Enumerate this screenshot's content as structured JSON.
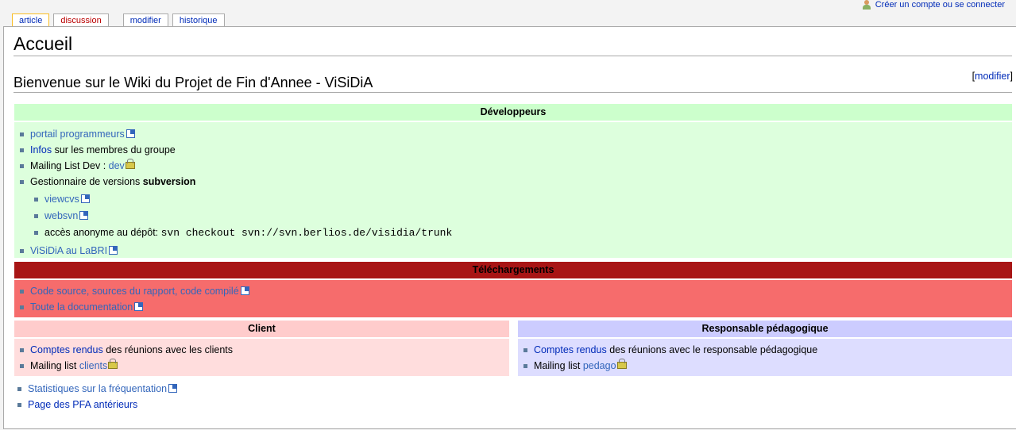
{
  "tabs": [
    "article",
    "discussion",
    "modifier",
    "historique"
  ],
  "personal": "Créer un compte ou se connecter",
  "title": "Accueil",
  "heading": "Bienvenue sur le Wiki du Projet de Fin d'Annee - ViSiDiA",
  "edit": {
    "open": "[",
    "label": "modifier",
    "close": "]"
  },
  "dev": {
    "header": "Développeurs",
    "i1": "portail programmeurs",
    "i2a": "Infos",
    "i2b": " sur les membres du groupe",
    "i3a": "Mailing List Dev : ",
    "i3b": "dev",
    "i4a": "Gestionnaire de versions ",
    "i4b": "subversion",
    "s1": "viewcvs",
    "s2": "websvn",
    "s3a": "accès anonyme au dépôt: ",
    "s3b": "svn checkout svn://svn.berlios.de/visidia/trunk",
    "i5": "ViSiDiA au LaBRI"
  },
  "dl": {
    "header": "Téléchargements",
    "i1": "Code source, sources du rapport, code compilé",
    "i2": "Toute la documentation"
  },
  "client": {
    "header": "Client",
    "i1a": "Comptes rendus",
    "i1b": " des réunions avec les clients",
    "i2a": "Mailing list ",
    "i2b": "clients"
  },
  "resp": {
    "header": "Responsable pédagogique",
    "i1a": "Comptes rendus",
    "i1b": " des réunions avec le responsable pédagogique",
    "i2a": "Mailing list ",
    "i2b": "pedago"
  },
  "bottom": [
    "Statistiques sur la fréquentation",
    "Page des PFA antérieurs"
  ]
}
